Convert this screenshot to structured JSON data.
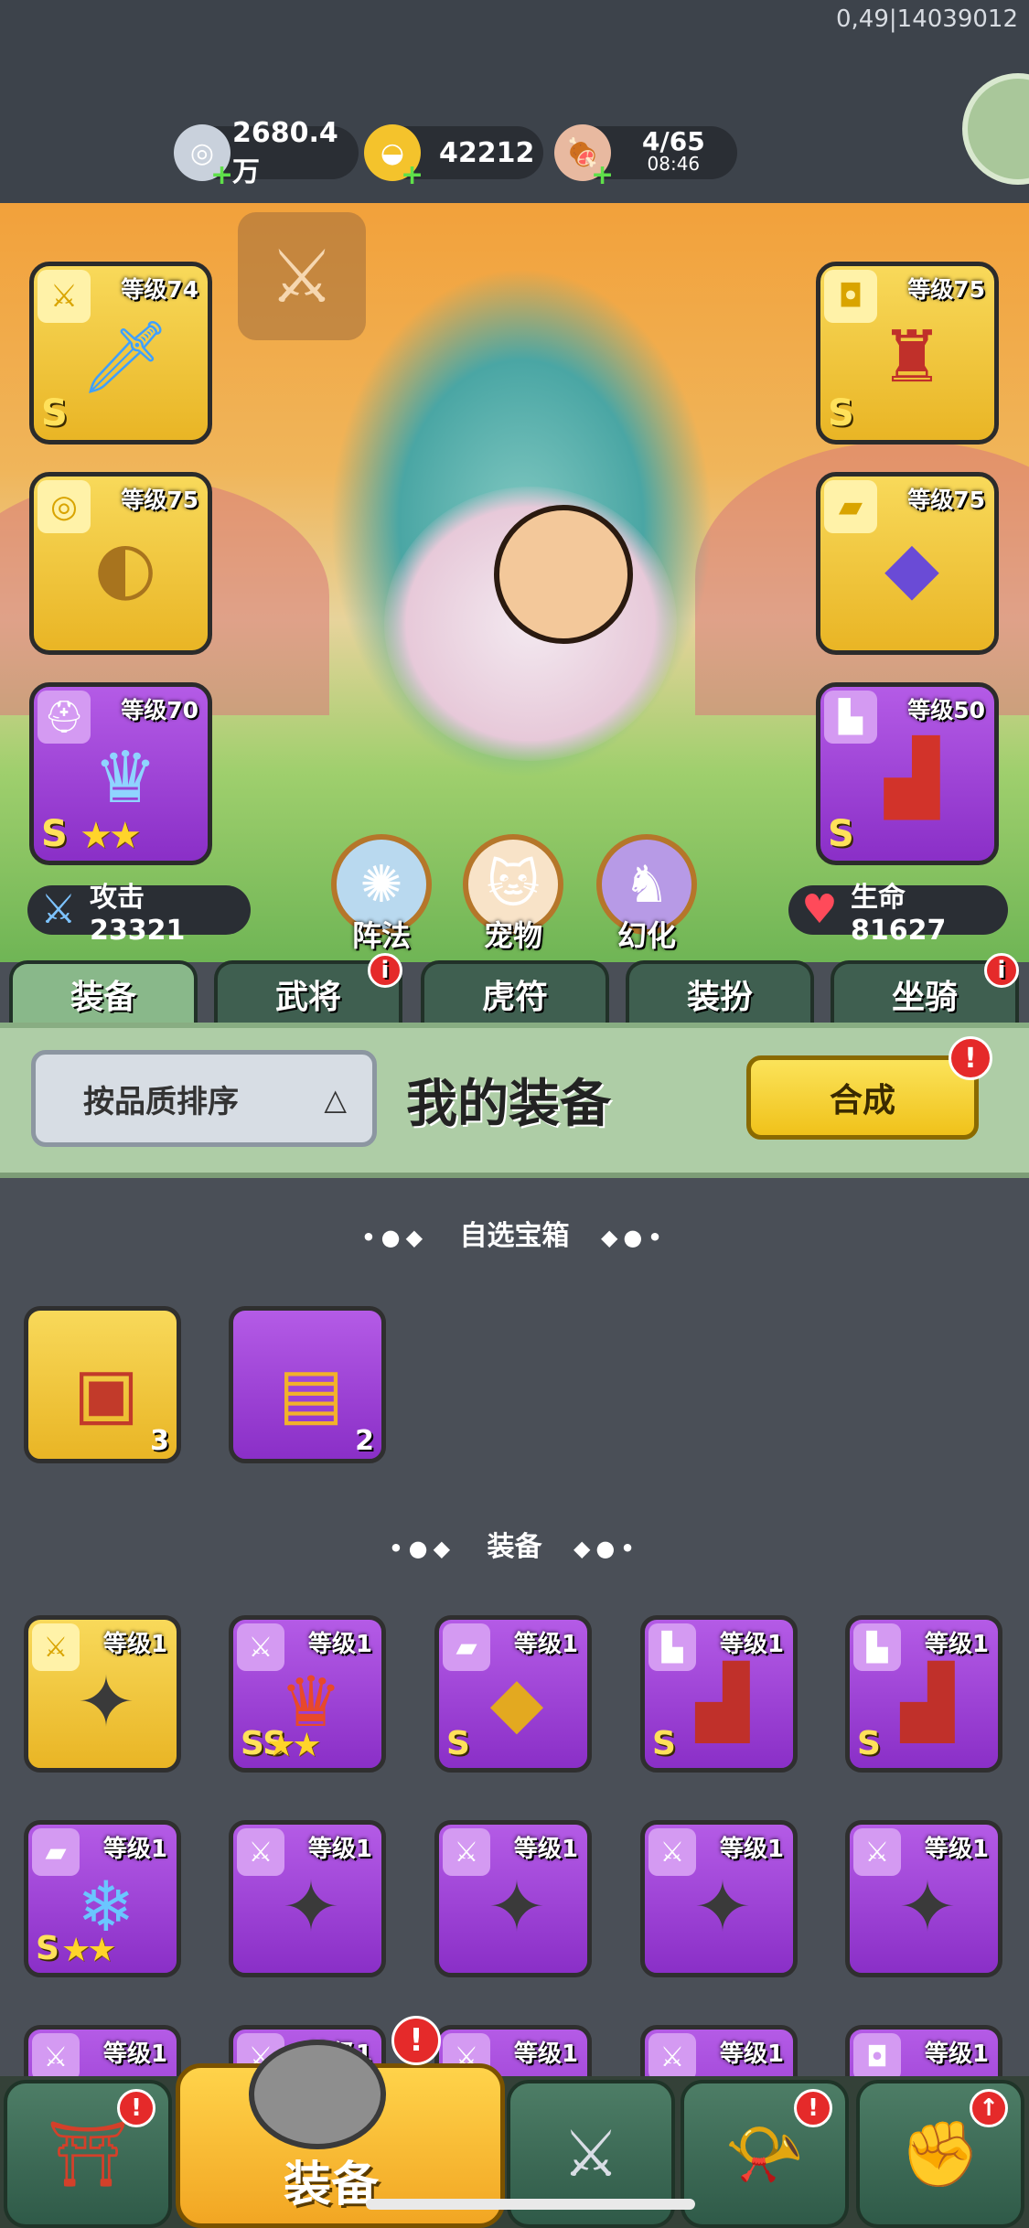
{
  "build_id": "0,49|14039012",
  "resources": {
    "silver": {
      "icon": "silver-coin-icon",
      "value": "2680.4万"
    },
    "gold": {
      "icon": "gold-ingot-icon",
      "value": "42212"
    },
    "stamina": {
      "icon": "meat-icon",
      "value": "4/65",
      "timer": "08:46"
    }
  },
  "equipped": {
    "weapon": {
      "level": "等级74",
      "grade": "S",
      "stars": "",
      "icon": "sword-icon",
      "color": "gold"
    },
    "medal": {
      "level": "等级75",
      "grade": "",
      "stars": "",
      "icon": "necklace-icon",
      "color": "gold"
    },
    "helmet": {
      "level": "等级70",
      "grade": "S",
      "stars": "★★",
      "icon": "helmet-icon",
      "color": "purple"
    },
    "armor": {
      "level": "等级75",
      "grade": "S",
      "stars": "",
      "icon": "armor-icon",
      "color": "gold"
    },
    "belt": {
      "level": "等级75",
      "grade": "",
      "stars": "",
      "icon": "belt-icon",
      "color": "gold"
    },
    "boots": {
      "level": "等级50",
      "grade": "S",
      "stars": "",
      "icon": "boots-icon",
      "color": "purple"
    }
  },
  "stats": {
    "attack": "攻击 23321",
    "life": "生命 81627"
  },
  "circle_buttons": [
    {
      "label": "阵法",
      "icon": "formation-icon"
    },
    {
      "label": "宠物",
      "icon": "cat-pet-icon"
    },
    {
      "label": "幻化",
      "icon": "transform-icon"
    }
  ],
  "tabs": [
    {
      "label": "装备",
      "active": true,
      "badge": ""
    },
    {
      "label": "武将",
      "active": false,
      "badge": "i"
    },
    {
      "label": "虎符",
      "active": false,
      "badge": ""
    },
    {
      "label": "装扮",
      "active": false,
      "badge": ""
    },
    {
      "label": "坐骑",
      "active": false,
      "badge": "i"
    }
  ],
  "panel": {
    "sort_label": "按品质排序",
    "sort_arrow": "△",
    "title": "我的装备",
    "combine_label": "合成",
    "combine_badge": "!"
  },
  "sections": {
    "chests_title": "自选宝箱",
    "equip_title": "装备",
    "dots_left": "•●◆",
    "dots_right": "◆●•"
  },
  "chests": [
    {
      "count": "3",
      "color": "gold",
      "icon": "treasure-chest-icon"
    },
    {
      "count": "2",
      "color": "purple",
      "icon": "lion-chest-icon"
    }
  ],
  "items": [
    {
      "level": "等级1",
      "color": "gold",
      "tag": "sword-icon",
      "art": "shuriken-icon",
      "grade": "",
      "stars": ""
    },
    {
      "level": "等级1",
      "color": "purple",
      "tag": "sword-icon",
      "art": "dragon-helm-icon",
      "grade": "SS",
      "stars": "★★"
    },
    {
      "level": "等级1",
      "color": "purple",
      "tag": "belt-icon",
      "art": "gold-belt-icon",
      "grade": "S",
      "stars": ""
    },
    {
      "level": "等级1",
      "color": "purple",
      "tag": "boots-icon",
      "art": "boots-icon",
      "grade": "S",
      "stars": ""
    },
    {
      "level": "等级1",
      "color": "purple",
      "tag": "boots-icon",
      "art": "boots-icon",
      "grade": "S",
      "stars": ""
    },
    {
      "level": "等级1",
      "color": "purple",
      "tag": "belt-icon",
      "art": "ice-armor-icon",
      "grade": "S",
      "stars": "★★"
    },
    {
      "level": "等级1",
      "color": "purple",
      "tag": "sword-icon",
      "art": "shuriken-icon",
      "grade": "",
      "stars": ""
    },
    {
      "level": "等级1",
      "color": "purple",
      "tag": "sword-icon",
      "art": "shuriken-icon",
      "grade": "",
      "stars": ""
    },
    {
      "level": "等级1",
      "color": "purple",
      "tag": "sword-icon",
      "art": "shuriken-icon",
      "grade": "",
      "stars": ""
    },
    {
      "level": "等级1",
      "color": "purple",
      "tag": "sword-icon",
      "art": "shuriken-icon",
      "grade": "",
      "stars": ""
    },
    {
      "level": "等级1",
      "color": "purple",
      "tag": "sword-icon",
      "art": "",
      "grade": "",
      "stars": ""
    },
    {
      "level": "等级1",
      "color": "purple",
      "tag": "sword-icon",
      "art": "",
      "grade": "",
      "stars": ""
    },
    {
      "level": "等级1",
      "color": "purple",
      "tag": "sword-icon",
      "art": "",
      "grade": "",
      "stars": ""
    },
    {
      "level": "等级1",
      "color": "purple",
      "tag": "sword-icon",
      "art": "",
      "grade": "",
      "stars": ""
    },
    {
      "level": "等级1",
      "color": "purple",
      "tag": "armor-icon",
      "art": "",
      "grade": "",
      "stars": ""
    }
  ],
  "bottom_nav": [
    {
      "icon": "gate-icon",
      "badge": "!"
    },
    {
      "icon": "helmet-icon",
      "label": "装备",
      "badge": "!",
      "active": true
    },
    {
      "icon": "crossed-swords-icon",
      "badge": ""
    },
    {
      "icon": "horn-icon",
      "badge": "!"
    },
    {
      "icon": "fist-upgrade-icon",
      "badge": "↑"
    }
  ]
}
